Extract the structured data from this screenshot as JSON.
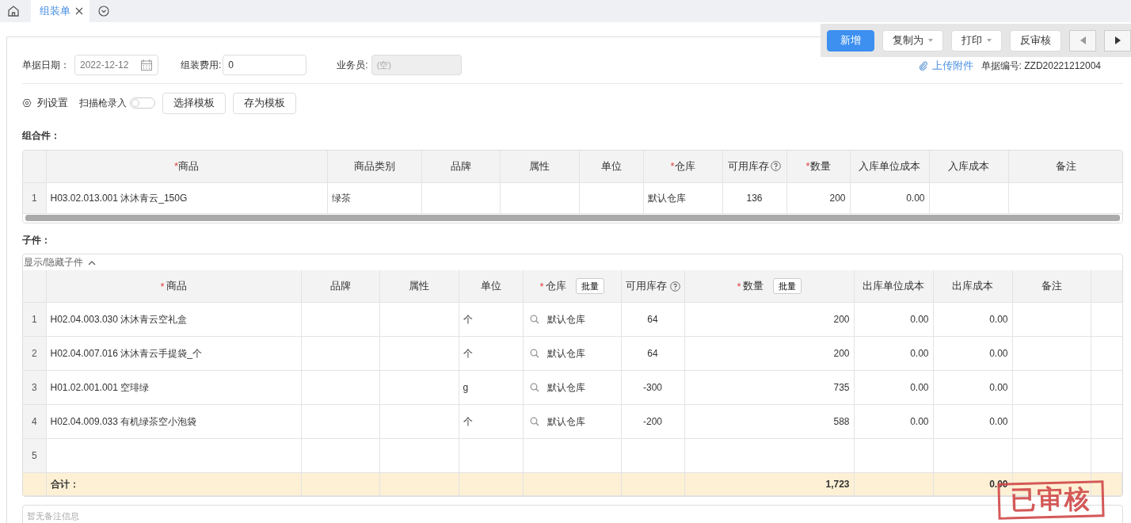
{
  "tabs": [
    {
      "label": "组装单",
      "selected": true
    }
  ],
  "actions": [
    {
      "label": "新增",
      "kind": "primary"
    },
    {
      "label": "复制为",
      "kind": "dropdown"
    },
    {
      "label": "打印",
      "kind": "dropdown"
    },
    {
      "label": "反审核",
      "kind": "plain"
    }
  ],
  "form": {
    "date": {
      "label": "单据日期：",
      "value": "2022-12-12"
    },
    "fee": {
      "label": "组装费用:",
      "value": "0"
    },
    "salesperson": {
      "label": "业务员:",
      "value": "(空)",
      "disabled": true
    },
    "upload": "上传附件",
    "doc_number": "单据编号: ZZD20221212004"
  },
  "toolbar": {
    "column_settings": "列设置",
    "scan": {
      "label": "扫描枪录入",
      "on": false
    },
    "buttons": [
      "选择模板",
      "存为模板"
    ]
  },
  "assembly": {
    "title": "组合件：",
    "columns": [
      {
        "label": "商品",
        "required_mark": "*",
        "kind": "text"
      },
      {
        "label": "商品类别",
        "kind": "text"
      },
      {
        "label": "品牌",
        "kind": "text"
      },
      {
        "label": "属性",
        "kind": "text"
      },
      {
        "label": "单位",
        "kind": "text"
      },
      {
        "label": "仓库",
        "required_mark": "*",
        "kind": "text"
      },
      {
        "label": "可用库存",
        "help": true,
        "kind": "center"
      },
      {
        "label": "数量",
        "required_mark": "*",
        "kind": "number"
      },
      {
        "label": "入库单位成本",
        "kind": "number"
      },
      {
        "label": "入库成本",
        "kind": "number"
      },
      {
        "label": "备注",
        "kind": "text"
      }
    ],
    "rows": [
      {
        "index": "1",
        "cells": [
          "H03.02.013.001 沐沐青云_150G",
          "绿茶",
          null,
          null,
          null,
          "默认仓库",
          "136",
          "200",
          "0.00",
          null,
          null
        ]
      }
    ]
  },
  "components": {
    "title": "子件：",
    "toggle": "显示/隐藏子件",
    "expanded": true,
    "columns": [
      {
        "label": "商品",
        "required_mark": "*",
        "kind": "text"
      },
      {
        "label": "品牌",
        "kind": "text"
      },
      {
        "label": "属性",
        "kind": "text"
      },
      {
        "label": "单位",
        "kind": "text"
      },
      {
        "label": "仓库",
        "required_mark": "*",
        "batch": "批量",
        "kind": "lookup"
      },
      {
        "label": "可用库存",
        "help": true,
        "kind": "center"
      },
      {
        "label": "数量",
        "required_mark": "*",
        "batch": "批量",
        "kind": "number"
      },
      {
        "label": "出库单位成本",
        "kind": "number"
      },
      {
        "label": "出库成本",
        "kind": "number"
      },
      {
        "label": "备注",
        "kind": "text"
      }
    ],
    "rows": [
      {
        "index": "1",
        "cells": [
          "H02.04.003.030 沐沐青云空礼盒",
          null,
          null,
          "个",
          "默认仓库",
          "64",
          "200",
          "0.00",
          "0.00",
          null
        ]
      },
      {
        "index": "2",
        "cells": [
          "H02.04.007.016 沐沐青云手提袋_个",
          null,
          null,
          "个",
          "默认仓库",
          "64",
          "200",
          "0.00",
          "0.00",
          null
        ]
      },
      {
        "index": "3",
        "cells": [
          "H01.02.001.001 空琲绿",
          null,
          null,
          "g",
          "默认仓库",
          "-300",
          "735",
          "0.00",
          "0.00",
          null
        ]
      },
      {
        "index": "4",
        "cells": [
          "H02.04.009.033 有机绿茶空小泡袋",
          null,
          null,
          "个",
          "默认仓库",
          "-200",
          "588",
          "0.00",
          "0.00",
          null
        ]
      },
      {
        "index": "5",
        "cells": [
          null,
          null,
          null,
          null,
          null,
          null,
          null,
          null,
          null,
          null
        ]
      }
    ],
    "totals": {
      "label": "合计：",
      "quantity": "1,723",
      "cost": "0.00"
    }
  },
  "notes": {
    "placeholder": "暂无备注信息"
  },
  "stamp": "已审核"
}
